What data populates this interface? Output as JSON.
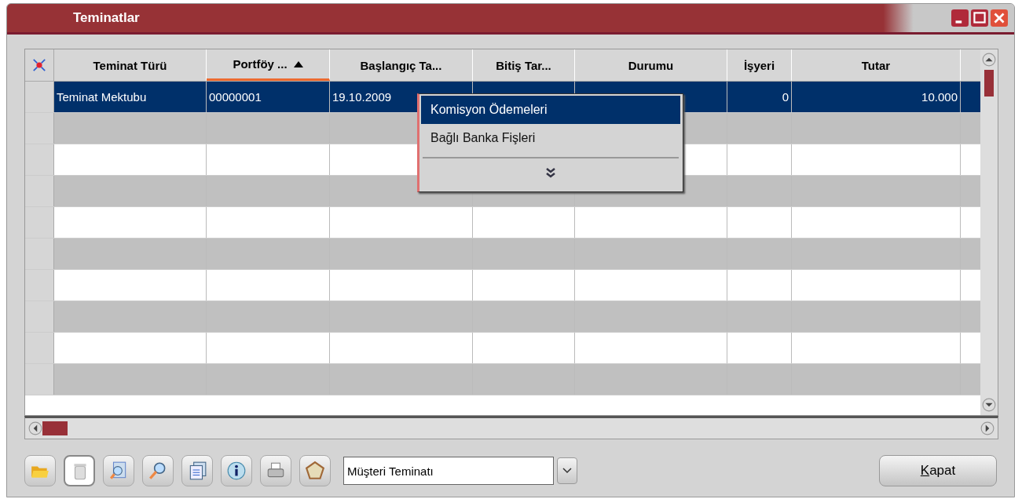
{
  "window": {
    "title": "Teminatlar"
  },
  "table": {
    "columns": [
      {
        "label": "Teminat Türü",
        "sorted": false,
        "kind": "text"
      },
      {
        "label": "Portföy ...",
        "sorted": true,
        "kind": "text"
      },
      {
        "label": "Başlangıç Ta...",
        "sorted": false,
        "kind": "text"
      },
      {
        "label": "Bitiş Tar...",
        "sorted": false,
        "kind": "text"
      },
      {
        "label": "Durumu",
        "sorted": false,
        "kind": "text"
      },
      {
        "label": "İşyeri",
        "sorted": false,
        "kind": "number"
      },
      {
        "label": "Tutar",
        "sorted": false,
        "kind": "number"
      }
    ],
    "rows": [
      {
        "selected": true,
        "cells": [
          "Teminat Mektubu",
          "00000001",
          "19.10.2009",
          null,
          null,
          "0",
          "10.000"
        ]
      }
    ]
  },
  "context_menu": {
    "items": [
      {
        "label": "Komisyon Ödemeleri",
        "selected": true
      },
      {
        "label": "Bağlı Banka Fişleri",
        "selected": false
      }
    ]
  },
  "filter_field": {
    "value": "Müşteri Teminatı"
  },
  "close_button": {
    "label": "Kapat"
  }
}
